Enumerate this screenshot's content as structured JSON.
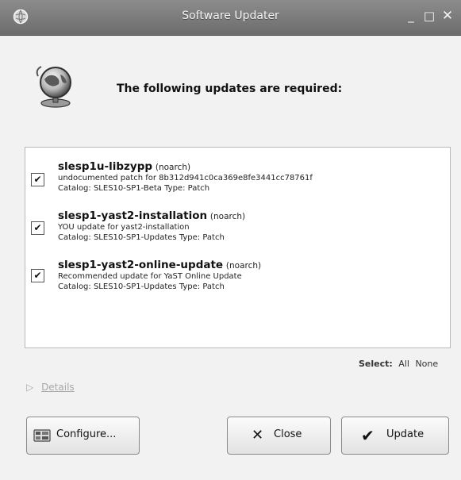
{
  "window": {
    "title": "Software Updater",
    "controls": {
      "minimize": "_",
      "maximize": "□",
      "close": "✕"
    }
  },
  "header": {
    "text": "The following updates are required:",
    "icon": "globe-network-icon"
  },
  "updates": [
    {
      "name": "slesp1u-libzypp",
      "arch": "(noarch)",
      "description": "undocumented patch for 8b312d941c0ca369e8fe3441cc78761f",
      "catalog": "Catalog: SLES10-SP1-Beta Type: Patch",
      "checked": true
    },
    {
      "name": "slesp1-yast2-installation",
      "arch": "(noarch)",
      "description": "YOU update for yast2-installation",
      "catalog": "Catalog: SLES10-SP1-Updates Type: Patch",
      "checked": true
    },
    {
      "name": "slesp1-yast2-online-update",
      "arch": "(noarch)",
      "description": "Recommended update for YaST Online Update",
      "catalog": "Catalog: SLES10-SP1-Updates Type: Patch",
      "checked": true
    }
  ],
  "select": {
    "label": "Select:",
    "all": "All",
    "none": "None"
  },
  "details": {
    "label": "Details"
  },
  "buttons": {
    "configure": "Configure...",
    "close": "Close",
    "update": "Update"
  }
}
